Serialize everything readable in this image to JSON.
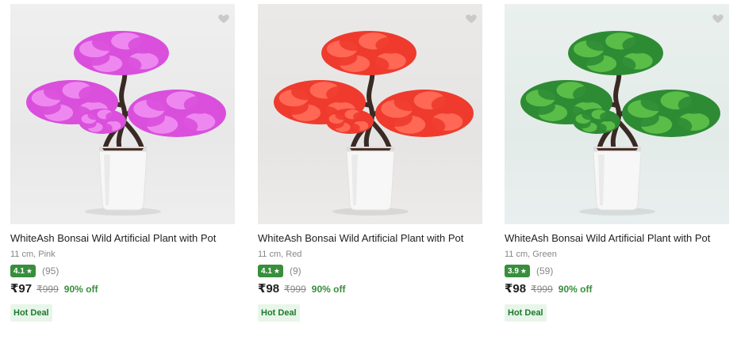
{
  "products": [
    {
      "title": "WhiteAsh Bonsai Wild Artificial Plant with Pot",
      "variant": "11 cm, Pink",
      "rating": "4.1",
      "rating_count": "(95)",
      "price": "₹97",
      "mrp": "₹999",
      "discount": "90% off",
      "badge": "Hot Deal",
      "foliage_color": "#d94fdc",
      "foliage_light": "#f08ef2",
      "icon": "heart-icon"
    },
    {
      "title": "WhiteAsh Bonsai Wild Artificial Plant with Pot",
      "variant": "11 cm, Red",
      "rating": "4.1",
      "rating_count": "(9)",
      "price": "₹98",
      "mrp": "₹999",
      "discount": "90% off",
      "badge": "Hot Deal",
      "foliage_color": "#ee3b2e",
      "foliage_light": "#ff6e5a",
      "icon": "heart-icon"
    },
    {
      "title": "WhiteAsh Bonsai Wild Artificial Plant with Pot",
      "variant": "11 cm, Green",
      "rating": "3.9",
      "rating_count": "(59)",
      "price": "₹98",
      "mrp": "₹999",
      "discount": "90% off",
      "badge": "Hot Deal",
      "foliage_color": "#2e8b34",
      "foliage_light": "#5fc24a",
      "icon": "heart-icon"
    }
  ],
  "colors": {
    "rating_badge": "#388e3c",
    "discount": "#388e3c",
    "deal_bg": "#e8f6ea",
    "muted": "#878787"
  }
}
